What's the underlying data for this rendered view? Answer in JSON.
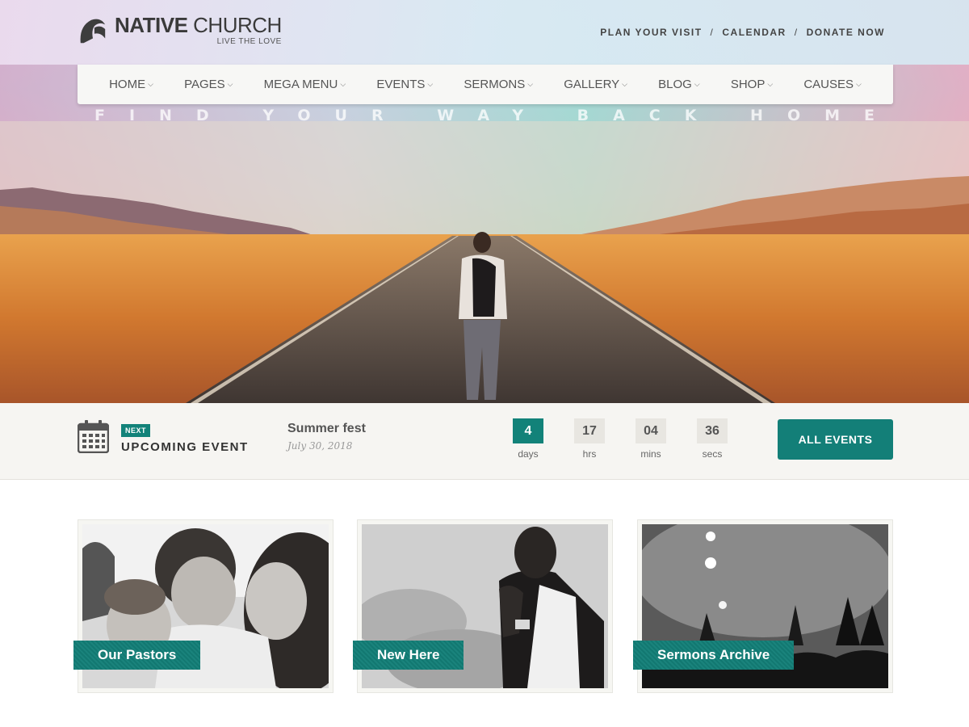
{
  "brand": {
    "name_bold": "NATIVE",
    "name_light": "CHURCH",
    "tagline": "LIVE THE LOVE"
  },
  "top_links": [
    {
      "label": "PLAN YOUR VISIT"
    },
    {
      "label": "CALENDAR"
    },
    {
      "label": "DONATE NOW"
    }
  ],
  "top_links_separator": "/",
  "nav": {
    "items": [
      {
        "label": "HOME"
      },
      {
        "label": "PAGES"
      },
      {
        "label": "MEGA MENU"
      },
      {
        "label": "EVENTS"
      },
      {
        "label": "SERMONS"
      },
      {
        "label": "GALLERY"
      },
      {
        "label": "BLOG"
      },
      {
        "label": "SHOP"
      },
      {
        "label": "CAUSES"
      }
    ],
    "chevron": "⌵"
  },
  "hero": {
    "tagline": "FIND YOUR WAY BACK HOME"
  },
  "event": {
    "badge": "NEXT",
    "heading": "UPCOMING EVENT",
    "name": "Summer fest",
    "date": "July 30, 2018",
    "countdown": [
      {
        "value": "4",
        "label": "days"
      },
      {
        "value": "17",
        "label": "hrs"
      },
      {
        "value": "04",
        "label": "mins"
      },
      {
        "value": "36",
        "label": "secs"
      }
    ],
    "button": "ALL EVENTS"
  },
  "cards": [
    {
      "label": "Our Pastors"
    },
    {
      "label": "New Here"
    },
    {
      "label": "Sermons Archive"
    }
  ],
  "colors": {
    "accent": "#137f78",
    "bar_bg": "#f6f5f2"
  }
}
